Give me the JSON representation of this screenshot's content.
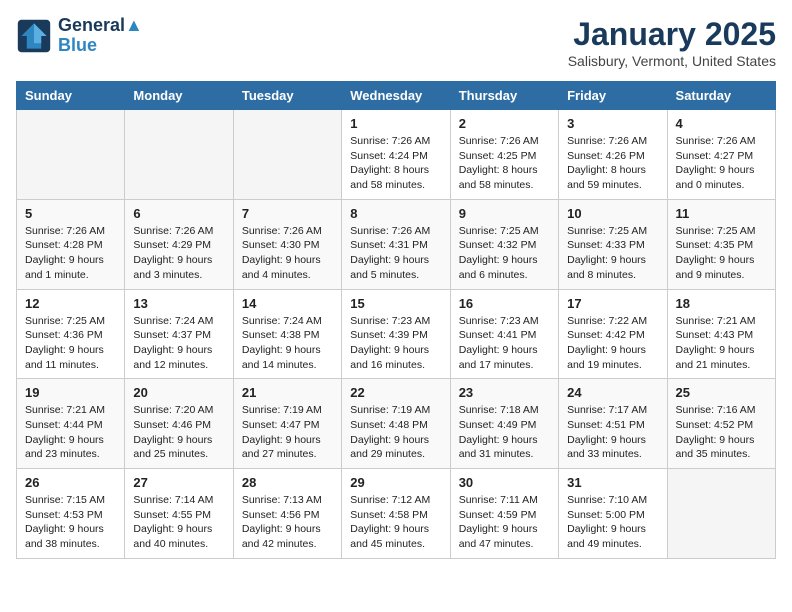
{
  "header": {
    "logo_line1": "General",
    "logo_line2": "Blue",
    "month": "January 2025",
    "location": "Salisbury, Vermont, United States"
  },
  "days_of_week": [
    "Sunday",
    "Monday",
    "Tuesday",
    "Wednesday",
    "Thursday",
    "Friday",
    "Saturday"
  ],
  "weeks": [
    [
      {
        "day": "",
        "info": ""
      },
      {
        "day": "",
        "info": ""
      },
      {
        "day": "",
        "info": ""
      },
      {
        "day": "1",
        "info": "Sunrise: 7:26 AM\nSunset: 4:24 PM\nDaylight: 8 hours and 58 minutes."
      },
      {
        "day": "2",
        "info": "Sunrise: 7:26 AM\nSunset: 4:25 PM\nDaylight: 8 hours and 58 minutes."
      },
      {
        "day": "3",
        "info": "Sunrise: 7:26 AM\nSunset: 4:26 PM\nDaylight: 8 hours and 59 minutes."
      },
      {
        "day": "4",
        "info": "Sunrise: 7:26 AM\nSunset: 4:27 PM\nDaylight: 9 hours and 0 minutes."
      }
    ],
    [
      {
        "day": "5",
        "info": "Sunrise: 7:26 AM\nSunset: 4:28 PM\nDaylight: 9 hours and 1 minute."
      },
      {
        "day": "6",
        "info": "Sunrise: 7:26 AM\nSunset: 4:29 PM\nDaylight: 9 hours and 3 minutes."
      },
      {
        "day": "7",
        "info": "Sunrise: 7:26 AM\nSunset: 4:30 PM\nDaylight: 9 hours and 4 minutes."
      },
      {
        "day": "8",
        "info": "Sunrise: 7:26 AM\nSunset: 4:31 PM\nDaylight: 9 hours and 5 minutes."
      },
      {
        "day": "9",
        "info": "Sunrise: 7:25 AM\nSunset: 4:32 PM\nDaylight: 9 hours and 6 minutes."
      },
      {
        "day": "10",
        "info": "Sunrise: 7:25 AM\nSunset: 4:33 PM\nDaylight: 9 hours and 8 minutes."
      },
      {
        "day": "11",
        "info": "Sunrise: 7:25 AM\nSunset: 4:35 PM\nDaylight: 9 hours and 9 minutes."
      }
    ],
    [
      {
        "day": "12",
        "info": "Sunrise: 7:25 AM\nSunset: 4:36 PM\nDaylight: 9 hours and 11 minutes."
      },
      {
        "day": "13",
        "info": "Sunrise: 7:24 AM\nSunset: 4:37 PM\nDaylight: 9 hours and 12 minutes."
      },
      {
        "day": "14",
        "info": "Sunrise: 7:24 AM\nSunset: 4:38 PM\nDaylight: 9 hours and 14 minutes."
      },
      {
        "day": "15",
        "info": "Sunrise: 7:23 AM\nSunset: 4:39 PM\nDaylight: 9 hours and 16 minutes."
      },
      {
        "day": "16",
        "info": "Sunrise: 7:23 AM\nSunset: 4:41 PM\nDaylight: 9 hours and 17 minutes."
      },
      {
        "day": "17",
        "info": "Sunrise: 7:22 AM\nSunset: 4:42 PM\nDaylight: 9 hours and 19 minutes."
      },
      {
        "day": "18",
        "info": "Sunrise: 7:21 AM\nSunset: 4:43 PM\nDaylight: 9 hours and 21 minutes."
      }
    ],
    [
      {
        "day": "19",
        "info": "Sunrise: 7:21 AM\nSunset: 4:44 PM\nDaylight: 9 hours and 23 minutes."
      },
      {
        "day": "20",
        "info": "Sunrise: 7:20 AM\nSunset: 4:46 PM\nDaylight: 9 hours and 25 minutes."
      },
      {
        "day": "21",
        "info": "Sunrise: 7:19 AM\nSunset: 4:47 PM\nDaylight: 9 hours and 27 minutes."
      },
      {
        "day": "22",
        "info": "Sunrise: 7:19 AM\nSunset: 4:48 PM\nDaylight: 9 hours and 29 minutes."
      },
      {
        "day": "23",
        "info": "Sunrise: 7:18 AM\nSunset: 4:49 PM\nDaylight: 9 hours and 31 minutes."
      },
      {
        "day": "24",
        "info": "Sunrise: 7:17 AM\nSunset: 4:51 PM\nDaylight: 9 hours and 33 minutes."
      },
      {
        "day": "25",
        "info": "Sunrise: 7:16 AM\nSunset: 4:52 PM\nDaylight: 9 hours and 35 minutes."
      }
    ],
    [
      {
        "day": "26",
        "info": "Sunrise: 7:15 AM\nSunset: 4:53 PM\nDaylight: 9 hours and 38 minutes."
      },
      {
        "day": "27",
        "info": "Sunrise: 7:14 AM\nSunset: 4:55 PM\nDaylight: 9 hours and 40 minutes."
      },
      {
        "day": "28",
        "info": "Sunrise: 7:13 AM\nSunset: 4:56 PM\nDaylight: 9 hours and 42 minutes."
      },
      {
        "day": "29",
        "info": "Sunrise: 7:12 AM\nSunset: 4:58 PM\nDaylight: 9 hours and 45 minutes."
      },
      {
        "day": "30",
        "info": "Sunrise: 7:11 AM\nSunset: 4:59 PM\nDaylight: 9 hours and 47 minutes."
      },
      {
        "day": "31",
        "info": "Sunrise: 7:10 AM\nSunset: 5:00 PM\nDaylight: 9 hours and 49 minutes."
      },
      {
        "day": "",
        "info": ""
      }
    ]
  ]
}
